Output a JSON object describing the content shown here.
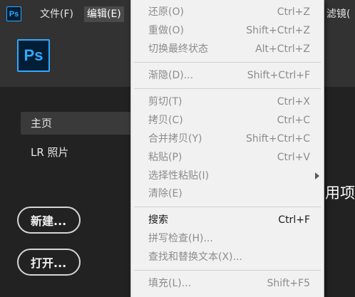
{
  "app": {
    "logo_text": "Ps"
  },
  "menubar": {
    "items": [
      {
        "label": "文件(F)",
        "active": false
      },
      {
        "label": "编辑(E)",
        "active": true
      },
      {
        "label": "滤镜("
      }
    ]
  },
  "sidebar": {
    "items": [
      {
        "label": "主页",
        "selected": true
      },
      {
        "label": "LR 照片",
        "selected": false
      }
    ],
    "new_label": "新建...",
    "open_label": "打开..."
  },
  "main": {
    "partial_text": "用项"
  },
  "edit_menu": {
    "groups": [
      [
        {
          "label": "还原(O)",
          "shortcut": "Ctrl+Z",
          "enabled": false
        },
        {
          "label": "重做(O)",
          "shortcut": "Shift+Ctrl+Z",
          "enabled": false
        },
        {
          "label": "切换最终状态",
          "shortcut": "Alt+Ctrl+Z",
          "enabled": false
        }
      ],
      [
        {
          "label": "渐隐(D)...",
          "shortcut": "Shift+Ctrl+F",
          "enabled": false
        }
      ],
      [
        {
          "label": "剪切(T)",
          "shortcut": "Ctrl+X",
          "enabled": false
        },
        {
          "label": "拷贝(C)",
          "shortcut": "Ctrl+C",
          "enabled": false
        },
        {
          "label": "合并拷贝(Y)",
          "shortcut": "Shift+Ctrl+C",
          "enabled": false
        },
        {
          "label": "粘贴(P)",
          "shortcut": "Ctrl+V",
          "enabled": false
        },
        {
          "label": "选择性粘贴(I)",
          "shortcut": "",
          "enabled": false,
          "submenu": true
        },
        {
          "label": "清除(E)",
          "shortcut": "",
          "enabled": false
        }
      ],
      [
        {
          "label": "搜索",
          "shortcut": "Ctrl+F",
          "enabled": true
        },
        {
          "label": "拼写检查(H)...",
          "shortcut": "",
          "enabled": false
        },
        {
          "label": "查找和替换文本(X)...",
          "shortcut": "",
          "enabled": false
        }
      ],
      [
        {
          "label": "填充(L)...",
          "shortcut": "Shift+F5",
          "enabled": false
        }
      ]
    ]
  },
  "colors": {
    "ps_blue": "#31a8ff",
    "ps_dark": "#001e36",
    "menu_bg": "#f1f1f1",
    "app_bg": "#222222",
    "bar_bg": "#323232"
  }
}
